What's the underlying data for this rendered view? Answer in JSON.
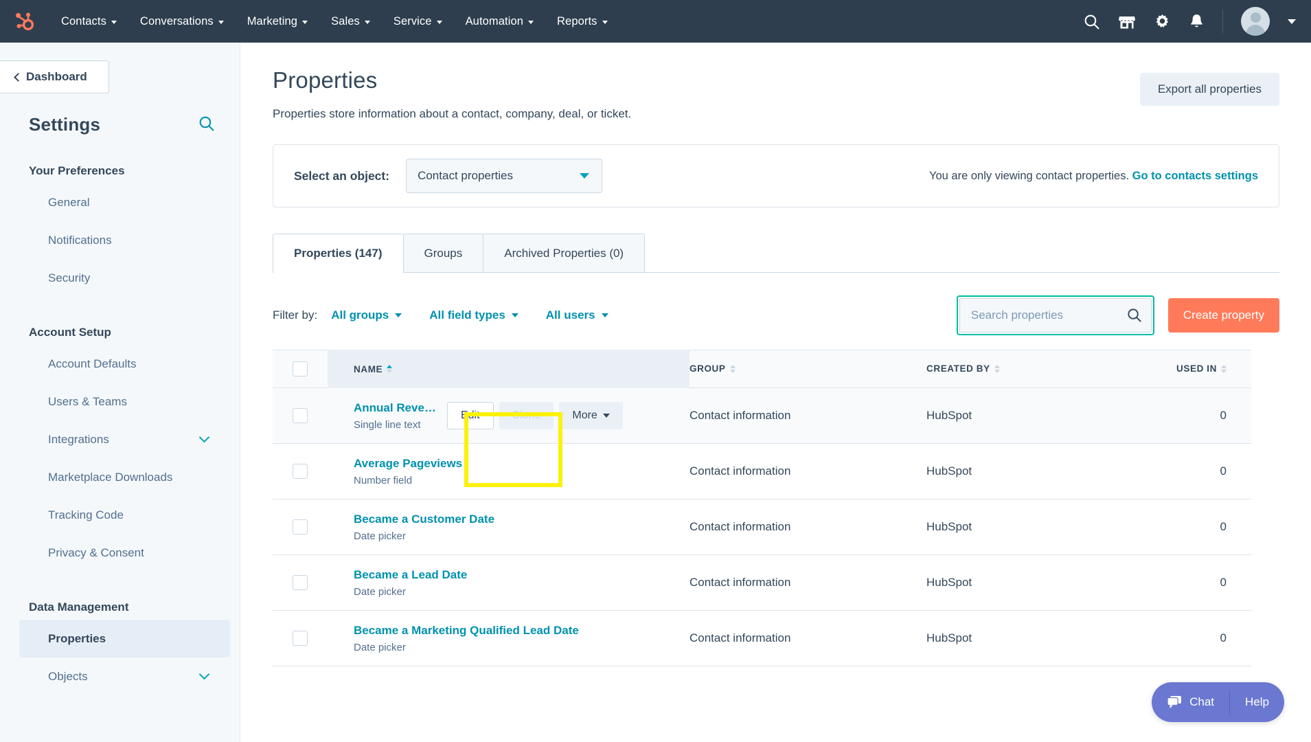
{
  "topnav": {
    "logo_icon": "hubspot-logo-icon",
    "menu": [
      {
        "label": "Contacts"
      },
      {
        "label": "Conversations"
      },
      {
        "label": "Marketing"
      },
      {
        "label": "Sales"
      },
      {
        "label": "Service"
      },
      {
        "label": "Automation"
      },
      {
        "label": "Reports"
      }
    ],
    "icons": [
      {
        "name": "search-icon"
      },
      {
        "name": "marketplace-icon"
      },
      {
        "name": "gear-icon"
      },
      {
        "name": "notifications-bell-icon"
      }
    ],
    "avatar_name": "user-avatar"
  },
  "sidebar": {
    "back_button": "Dashboard",
    "title": "Settings",
    "search_icon": "search-icon",
    "sections": [
      {
        "heading": "Your Preferences",
        "items": [
          {
            "label": "General",
            "expandable": false
          },
          {
            "label": "Notifications",
            "expandable": false
          },
          {
            "label": "Security",
            "expandable": false
          }
        ]
      },
      {
        "heading": "Account Setup",
        "items": [
          {
            "label": "Account Defaults",
            "expandable": false
          },
          {
            "label": "Users & Teams",
            "expandable": false
          },
          {
            "label": "Integrations",
            "expandable": true
          },
          {
            "label": "Marketplace Downloads",
            "expandable": false
          },
          {
            "label": "Tracking Code",
            "expandable": false
          },
          {
            "label": "Privacy & Consent",
            "expandable": false
          }
        ]
      },
      {
        "heading": "Data Management",
        "items": [
          {
            "label": "Properties",
            "expandable": false,
            "active": true
          },
          {
            "label": "Objects",
            "expandable": true
          }
        ]
      }
    ]
  },
  "header": {
    "title": "Properties",
    "subtitle": "Properties store information about a contact, company, deal, or ticket.",
    "export_button": "Export all properties"
  },
  "object_card": {
    "label": "Select an object:",
    "selected": "Contact properties",
    "note_text": "You are only viewing contact properties.",
    "note_link": "Go to contacts settings"
  },
  "tabs": [
    {
      "label": "Properties (147)",
      "active": true
    },
    {
      "label": "Groups",
      "active": false
    },
    {
      "label": "Archived Properties (0)",
      "active": false
    }
  ],
  "filters": {
    "label": "Filter by:",
    "dropdowns": [
      "All groups",
      "All field types",
      "All users"
    ]
  },
  "search": {
    "placeholder": "Search properties",
    "value": "",
    "icon": "search-icon"
  },
  "create_button": "Create property",
  "table": {
    "columns": [
      {
        "key": "name",
        "label": "NAME",
        "sort": "asc"
      },
      {
        "key": "group",
        "label": "GROUP",
        "sort": "none"
      },
      {
        "key": "created_by",
        "label": "CREATED BY",
        "sort": "none"
      },
      {
        "key": "used_in",
        "label": "USED IN",
        "sort": "none"
      }
    ],
    "row_action_labels": {
      "edit": "Edit",
      "clone": "Clone",
      "more": "More"
    },
    "rows": [
      {
        "name": "Annual Reve…",
        "type": "Single line text",
        "group": "Contact information",
        "created_by": "HubSpot",
        "used_in": "0",
        "actions_visible": true
      },
      {
        "name": "Average Pageviews",
        "type": "Number field",
        "group": "Contact information",
        "created_by": "HubSpot",
        "used_in": "0",
        "actions_visible": false
      },
      {
        "name": "Became a Customer Date",
        "type": "Date picker",
        "group": "Contact information",
        "created_by": "HubSpot",
        "used_in": "0",
        "actions_visible": false
      },
      {
        "name": "Became a Lead Date",
        "type": "Date picker",
        "group": "Contact information",
        "created_by": "HubSpot",
        "used_in": "0",
        "actions_visible": false
      },
      {
        "name": "Became a Marketing Qualified Lead Date",
        "type": "Date picker",
        "group": "Contact information",
        "created_by": "HubSpot",
        "used_in": "0",
        "actions_visible": false
      }
    ]
  },
  "chat_widget": {
    "chat_label": "Chat",
    "help_label": "Help",
    "chat_icon": "chat-bubble-icon"
  },
  "colors": {
    "navy": "#2e3e4e",
    "teal_link": "#0091ae",
    "accent_orange": "#ff7a59",
    "highlight_yellow": "#fbf10a",
    "chat_purple": "#6a78d1",
    "focus_ring": "#00bda5"
  }
}
